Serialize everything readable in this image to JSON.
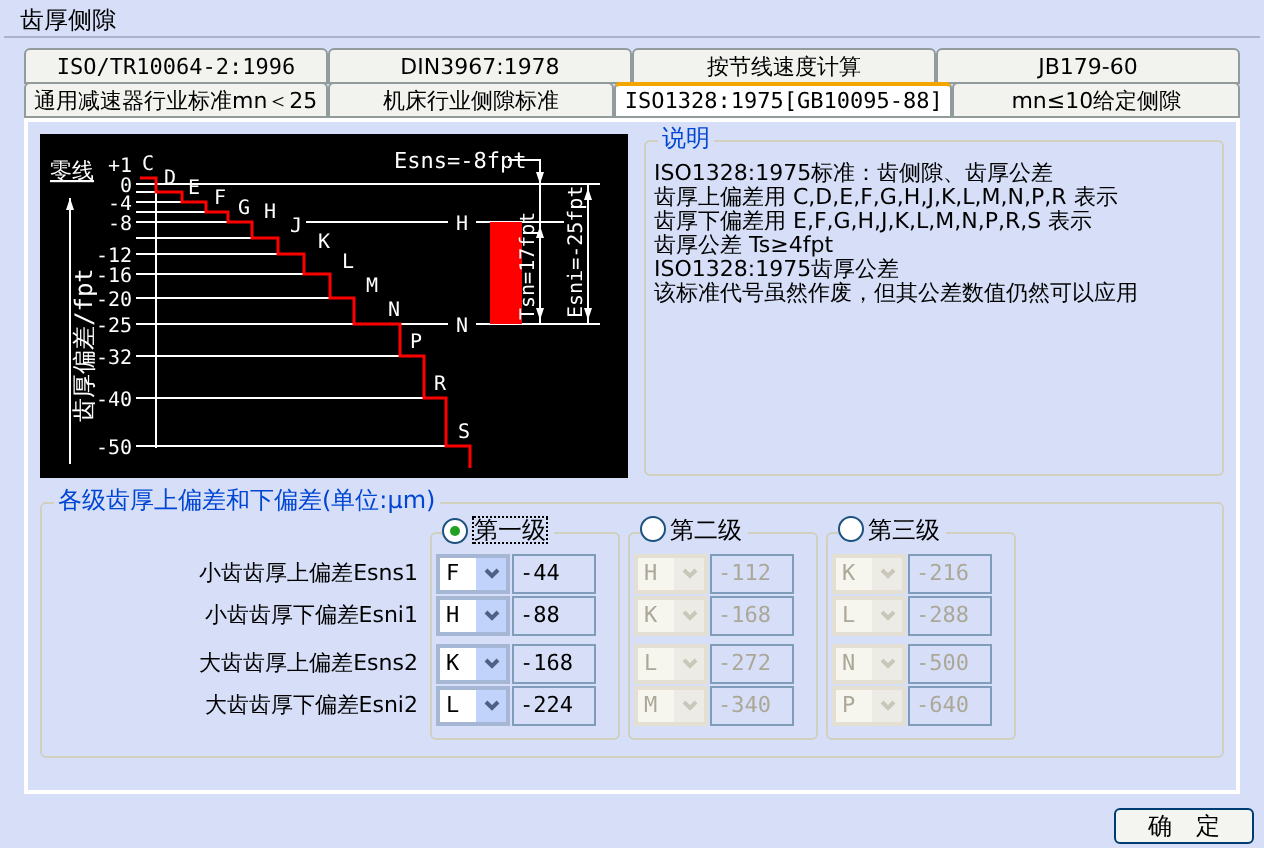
{
  "window": {
    "title": "齿厚侧隙"
  },
  "tab_rows": [
    {
      "tabs": [
        {
          "label": "ISO/TR10064-2:1996",
          "selected": false
        },
        {
          "label": "DIN3967:1978",
          "selected": false
        },
        {
          "label": "按节线速度计算",
          "selected": false
        },
        {
          "label": "JB179-60",
          "selected": false
        }
      ]
    },
    {
      "tabs": [
        {
          "label": "通用减速器行业标准mn＜25",
          "selected": false
        },
        {
          "label": "机床行业侧隙标准",
          "selected": false
        },
        {
          "label": "ISO1328:1975[GB10095-88]",
          "selected": true
        },
        {
          "label": "mn≤10给定侧隙",
          "selected": false
        }
      ]
    }
  ],
  "diagram": {
    "zero_line_label": "零线",
    "axis_label": "齿厚偏差/fpt",
    "ticks": [
      "+1",
      "0",
      "-4",
      "-8",
      "-12",
      "-16",
      "-20",
      "-25",
      "-32",
      "-40",
      "-50"
    ],
    "letters": [
      "C",
      "D",
      "E",
      "F",
      "G",
      "H",
      "J",
      "K",
      "L",
      "M",
      "N",
      "P",
      "R",
      "S"
    ],
    "upper_label": "H",
    "lower_label": "N",
    "esns": "Esns=-8fpt",
    "tsn": "Tsn=17fpt",
    "esni": "Esni=-25fpt"
  },
  "description": {
    "title": "说明",
    "lines": [
      "ISO1328:1975标准：齿侧隙、齿厚公差",
      "齿厚上偏差用 C,D,E,F,G,H,J,K,L,M,N,P,R 表示",
      "齿厚下偏差用 E,F,G,H,J,K,L,M,N,P,R,S 表示",
      "齿厚公差 Ts≥4fpt",
      "ISO1328:1975齿厚公差",
      "该标准代号虽然作废，但其公差数值仍然可以应用"
    ]
  },
  "deviations": {
    "title": "各级齿厚上偏差和下偏差(单位:μm)",
    "row_labels": [
      "小齿齿厚上偏差Esns1",
      "小齿齿厚下偏差Esni1",
      "大齿齿厚上偏差Esns2",
      "大齿齿厚下偏差Esni2"
    ],
    "levels": [
      {
        "label": "第一级",
        "selected": true,
        "disabled": false,
        "rows": [
          {
            "grade": "F",
            "value": "-44"
          },
          {
            "grade": "H",
            "value": "-88"
          },
          {
            "grade": "K",
            "value": "-168"
          },
          {
            "grade": "L",
            "value": "-224"
          }
        ]
      },
      {
        "label": "第二级",
        "selected": false,
        "disabled": true,
        "rows": [
          {
            "grade": "H",
            "value": "-112"
          },
          {
            "grade": "K",
            "value": "-168"
          },
          {
            "grade": "L",
            "value": "-272"
          },
          {
            "grade": "M",
            "value": "-340"
          }
        ]
      },
      {
        "label": "第三级",
        "selected": false,
        "disabled": true,
        "rows": [
          {
            "grade": "K",
            "value": "-216"
          },
          {
            "grade": "L",
            "value": "-288"
          },
          {
            "grade": "N",
            "value": "-500"
          },
          {
            "grade": "P",
            "value": "-640"
          }
        ]
      }
    ]
  },
  "buttons": [
    "确　定"
  ]
}
